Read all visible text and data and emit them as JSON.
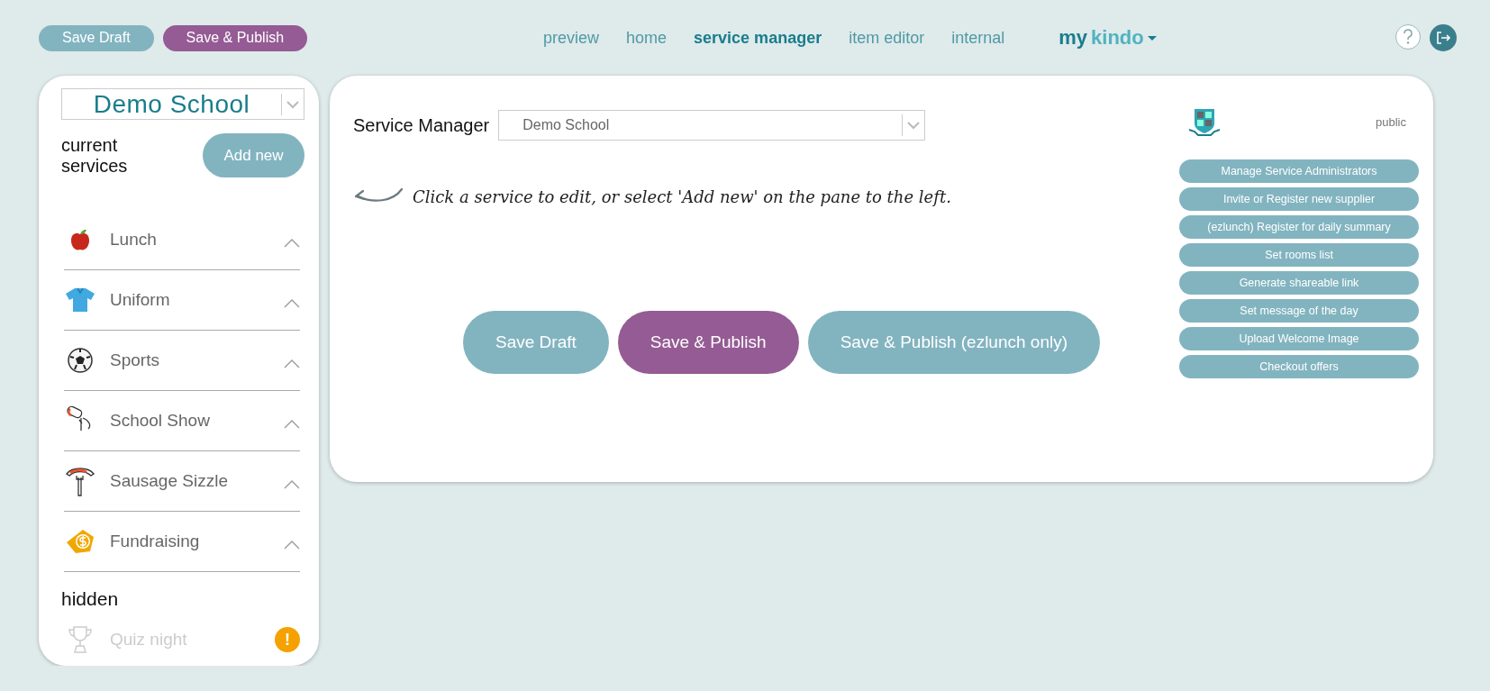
{
  "toolbar": {
    "buttons": [
      {
        "label": "Save Draft",
        "kind": "draft"
      },
      {
        "label": "Save & Publish",
        "kind": "publish"
      }
    ]
  },
  "nav": {
    "links": [
      {
        "label": "preview",
        "selected": false
      },
      {
        "label": "home",
        "selected": false
      },
      {
        "label": "service manager",
        "selected": true
      },
      {
        "label": "item editor",
        "selected": false
      },
      {
        "label": "internal",
        "selected": false
      }
    ],
    "brand": {
      "first": "my",
      "second": "kindo"
    }
  },
  "sidebar": {
    "school_select": {
      "value": "Demo School"
    },
    "heading": "current services",
    "add_button": "Add new",
    "services": [
      {
        "label": "Lunch",
        "kind": "apple"
      },
      {
        "label": "Uniform",
        "kind": "shirt"
      },
      {
        "label": "Sports",
        "kind": "ball"
      },
      {
        "label": "School Show",
        "kind": "show"
      },
      {
        "label": "Sausage Sizzle",
        "kind": "sausage"
      },
      {
        "label": "Fundraising",
        "kind": "money"
      }
    ],
    "hidden_heading": "hidden",
    "hidden_services": [
      {
        "label": "Quiz night",
        "kind": "trophy",
        "warning": "!"
      }
    ]
  },
  "main": {
    "label": "Service Manager",
    "select": {
      "value": "Demo School"
    },
    "hint": "Click a service to edit, or select 'Add new' on the pane to the left.",
    "buttons": [
      {
        "label": "Save Draft",
        "kind": "draft"
      },
      {
        "label": "Save & Publish",
        "kind": "publish"
      },
      {
        "label": "Save & Publish (ezlunch only)",
        "kind": "draft"
      }
    ],
    "visibility": "public",
    "actions": [
      "Manage Service Administrators",
      "Invite or Register new supplier",
      "(ezlunch) Register for daily summary",
      "Set rooms list",
      "Generate shareable link",
      "Set message of the day",
      "Upload Welcome Image",
      "Checkout offers"
    ]
  }
}
